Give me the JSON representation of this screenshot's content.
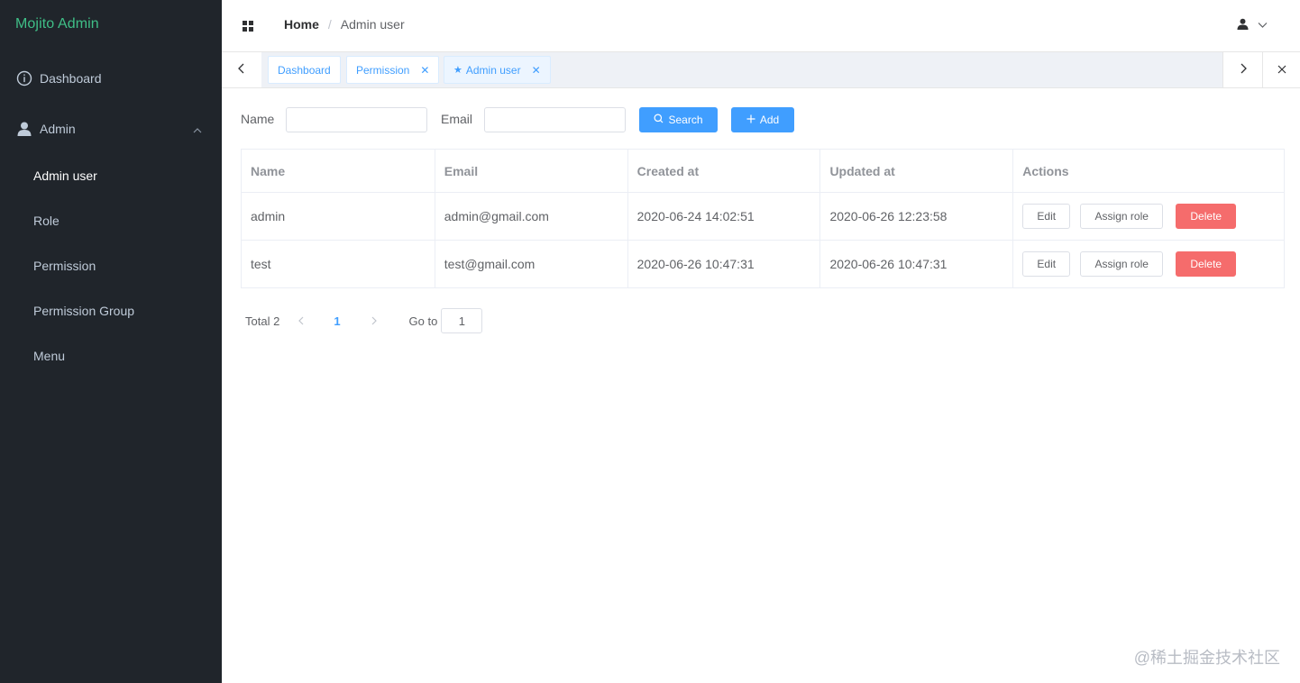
{
  "sidebar": {
    "brand": "Mojito Admin",
    "menu": [
      {
        "label": "Dashboard",
        "icon": "info-circle-icon"
      },
      {
        "label": "Admin",
        "icon": "user-icon",
        "expanded": true
      }
    ],
    "submenu": [
      {
        "label": "Admin user",
        "active": true
      },
      {
        "label": "Role"
      },
      {
        "label": "Permission"
      },
      {
        "label": "Permission Group"
      },
      {
        "label": "Menu"
      }
    ]
  },
  "header": {
    "breadcrumb": {
      "home": "Home",
      "separator": "/",
      "current": "Admin user"
    },
    "user_icon": "user-icon",
    "dropdown_icon": "chevron-down-icon"
  },
  "tabs": [
    {
      "label": "Dashboard",
      "closable": false
    },
    {
      "label": "Permission",
      "closable": true
    },
    {
      "label": "Admin user",
      "closable": true,
      "active": true,
      "icon": "star-icon"
    }
  ],
  "search": {
    "name_label": "Name",
    "name_value": "",
    "email_label": "Email",
    "email_value": "",
    "search_button": "Search",
    "add_button": "Add"
  },
  "table": {
    "columns": [
      "Name",
      "Email",
      "Created at",
      "Updated at",
      "Actions"
    ],
    "rows": [
      {
        "name": "admin",
        "email": "admin@gmail.com",
        "created_at": "2020-06-24 14:02:51",
        "updated_at": "2020-06-26 12:23:58"
      },
      {
        "name": "test",
        "email": "test@gmail.com",
        "created_at": "2020-06-26 10:47:31",
        "updated_at": "2020-06-26 10:47:31"
      }
    ],
    "actions": {
      "edit": "Edit",
      "assign_role": "Assign role",
      "delete": "Delete"
    }
  },
  "pagination": {
    "total_text": "Total 2",
    "current_page": "1",
    "goto_label": "Go to",
    "goto_value": "1"
  },
  "watermark": "@稀土掘金技术社区",
  "colors": {
    "sidebar_bg": "#20252b",
    "brand": "#3fbf87",
    "primary": "#409eff",
    "danger": "#f56c6c"
  }
}
